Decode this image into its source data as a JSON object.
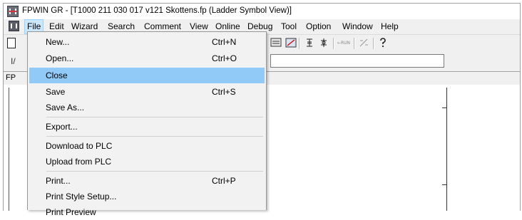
{
  "window": {
    "title": "FPWIN GR - [T1000 211 030 017 v121 Skottens.fp (Ladder Symbol View)]"
  },
  "menubar": {
    "items": [
      "File",
      "Edit",
      "Wizard",
      "Search",
      "Comment",
      "View",
      "Online",
      "Debug",
      "Tool",
      "Option",
      "Window",
      "Help"
    ],
    "active": "File"
  },
  "toolbar": {
    "run_label": "←RUN"
  },
  "toolbar2": {
    "label": "I/"
  },
  "child_window": {
    "label": "FP"
  },
  "file_menu": {
    "items": [
      {
        "label": "New...",
        "shortcut": "Ctrl+N"
      },
      {
        "label": "Open...",
        "shortcut": "Ctrl+O"
      },
      {
        "label": "Close",
        "shortcut": "",
        "highlighted": true
      },
      {
        "label": "Save",
        "shortcut": "Ctrl+S"
      },
      {
        "label": "Save As...",
        "shortcut": ""
      },
      {
        "label": "Export...",
        "shortcut": ""
      },
      {
        "label": "Download to PLC",
        "shortcut": ""
      },
      {
        "label": "Upload from PLC",
        "shortcut": ""
      },
      {
        "label": "Print...",
        "shortcut": "Ctrl+P"
      },
      {
        "label": "Print Style Setup...",
        "shortcut": ""
      },
      {
        "label": "Print Preview",
        "shortcut": ""
      }
    ]
  },
  "colors": {
    "highlight": "#91c9f7",
    "menu_active": "#cce8ff"
  }
}
